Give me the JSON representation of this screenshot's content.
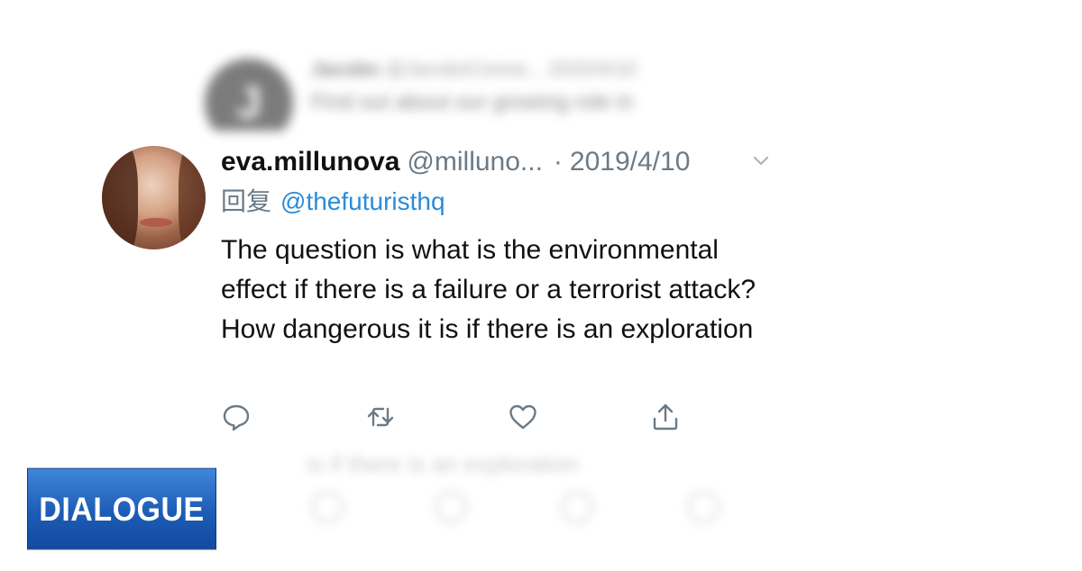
{
  "previous_tweet": {
    "author_initial": "J",
    "name": "Jacobs",
    "handle": "@JacobsConne...",
    "date": "2020/4/10",
    "text": "Find out about our growing role in"
  },
  "tweet": {
    "author_name": "eva.millunova",
    "author_handle": "@milluno...",
    "separator": "·",
    "date": "2019/4/10",
    "reply_label": "回复",
    "reply_to": "@thefuturisthq",
    "text": "The question is what is the environmental effect if there is a failure or a terrorist attack? How dangerous it is if there is an exploration",
    "actions": [
      "reply-icon",
      "retweet-icon",
      "like-icon",
      "share-icon"
    ],
    "colors": {
      "link": "#2a8cd8",
      "secondary": "#6b7a86",
      "text": "#111111"
    }
  },
  "next_tweet": {
    "text": "is if there is an exploration"
  },
  "badge": {
    "label": "DIALOGUE",
    "color": "#1d5cb6"
  }
}
